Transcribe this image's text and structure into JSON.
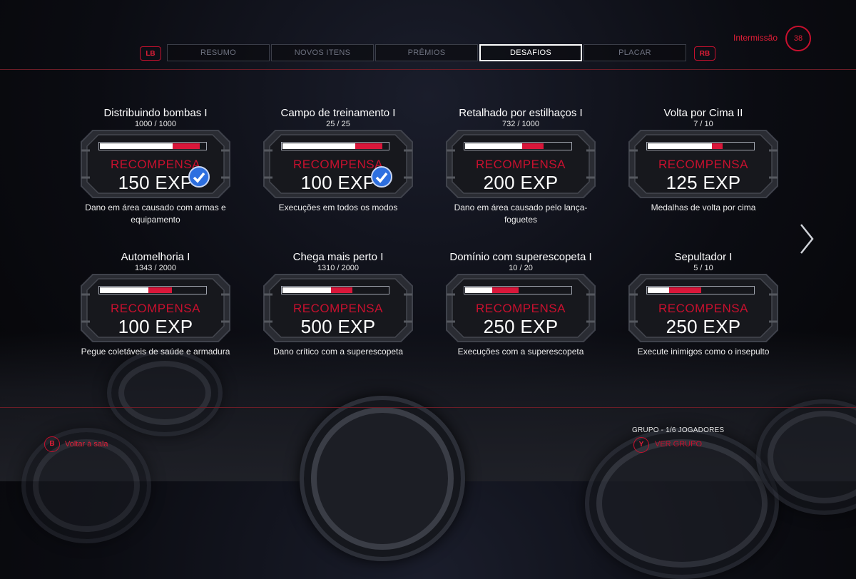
{
  "header": {
    "left_bumper": "LB",
    "right_bumper": "RB",
    "tabs": [
      {
        "label": "RESUMO",
        "active": false
      },
      {
        "label": "NOVOS ITENS",
        "active": false
      },
      {
        "label": "PRÊMIOS",
        "active": false
      },
      {
        "label": "DESAFIOS",
        "active": true
      },
      {
        "label": "PLACAR",
        "active": false
      }
    ],
    "intermission_label": "Intermissão",
    "timer_value": "38"
  },
  "colors": {
    "accent": "#c8102e",
    "progress_red": "#d9173a",
    "check_blue": "#2d6fe0"
  },
  "challenges": [
    {
      "title": "Distribuindo bombas I",
      "progress_text": "1000 / 1000",
      "progress_white": 0.68,
      "progress_red": 0.25,
      "reward_label": "RECOMPENSA",
      "reward_value": "150 EXP",
      "completed": true,
      "description": "Dano em área causado com armas e equipamento"
    },
    {
      "title": "Campo de treinamento I",
      "progress_text": "25 / 25",
      "progress_white": 0.68,
      "progress_red": 0.25,
      "reward_label": "RECOMPENSA",
      "reward_value": "100 EXP",
      "completed": true,
      "description": "Execuções em todos os modos"
    },
    {
      "title": "Retalhado por estilhaços I",
      "progress_text": "732 / 1000",
      "progress_white": 0.53,
      "progress_red": 0.2,
      "reward_label": "RECOMPENSA",
      "reward_value": "200 EXP",
      "completed": false,
      "description": "Dano em área causado pelo lança-foguetes"
    },
    {
      "title": "Volta por Cima II",
      "progress_text": "7 / 10",
      "progress_white": 0.6,
      "progress_red": 0.1,
      "reward_label": "RECOMPENSA",
      "reward_value": "125 EXP",
      "completed": false,
      "description": "Medalhas de volta por cima"
    },
    {
      "title": "Automelhoria I",
      "progress_text": "1343 / 2000",
      "progress_white": 0.45,
      "progress_red": 0.22,
      "reward_label": "RECOMPENSA",
      "reward_value": "100 EXP",
      "completed": false,
      "description": "Pegue coletáveis de saúde e armadura"
    },
    {
      "title": "Chega mais perto I",
      "progress_text": "1310 / 2000",
      "progress_white": 0.45,
      "progress_red": 0.2,
      "reward_label": "RECOMPENSA",
      "reward_value": "500 EXP",
      "completed": false,
      "description": "Dano crítico com a superescopeta"
    },
    {
      "title": "Domínio com superescopeta I",
      "progress_text": "10 / 20",
      "progress_white": 0.25,
      "progress_red": 0.25,
      "reward_label": "RECOMPENSA",
      "reward_value": "250 EXP",
      "completed": false,
      "description": "Execuções com a superescopeta"
    },
    {
      "title": "Sepultador I",
      "progress_text": "5 / 10",
      "progress_white": 0.2,
      "progress_red": 0.3,
      "reward_label": "RECOMPENSA",
      "reward_value": "250 EXP",
      "completed": false,
      "description": "Execute inimigos como o insepulto"
    }
  ],
  "footer": {
    "back_button": "B",
    "back_label": "Voltar à sala",
    "group_label": "GRUPO - 1/6 JOGADORES",
    "group_button": "Y",
    "group_action": "VER GRUPO"
  }
}
